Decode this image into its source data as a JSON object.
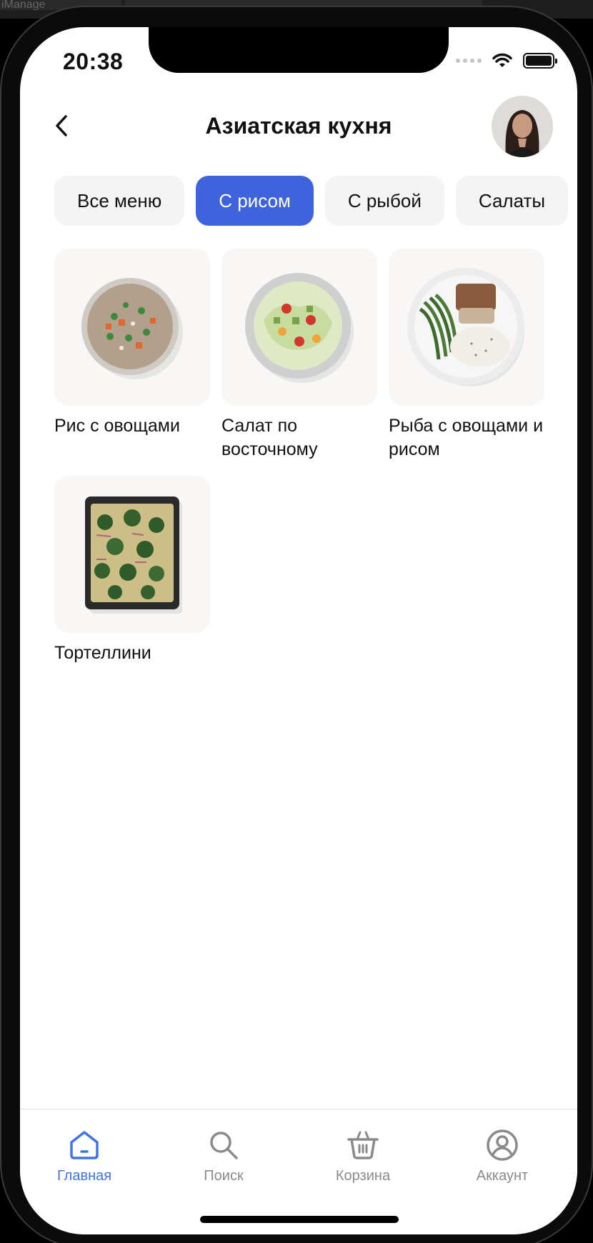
{
  "background_tab": {
    "label": "iManage"
  },
  "status_bar": {
    "time": "20:38"
  },
  "header": {
    "title": "Азиатская кухня"
  },
  "categories": [
    {
      "label": "Все меню",
      "active": false
    },
    {
      "label": "С рисом",
      "active": true
    },
    {
      "label": "С рыбой",
      "active": false
    },
    {
      "label": "Салаты",
      "active": false
    }
  ],
  "dishes": [
    {
      "name": "Рис с овощами",
      "image": "rice-with-vegetables-bowl"
    },
    {
      "name": "Салат по восточному",
      "image": "oriental-salad-bowl"
    },
    {
      "name": "Рыба с овощами и рисом",
      "image": "fish-vegetables-rice-plate"
    },
    {
      "name": "Тортеллини",
      "image": "tortellini-baking-tray"
    }
  ],
  "tabbar": {
    "items": [
      {
        "label": "Главная",
        "icon": "home-icon",
        "active": true
      },
      {
        "label": "Поиск",
        "icon": "search-icon",
        "active": false
      },
      {
        "label": "Корзина",
        "icon": "basket-icon",
        "active": false
      },
      {
        "label": "Аккаунт",
        "icon": "account-icon",
        "active": false
      }
    ]
  },
  "colors": {
    "accent": "#3E63DD",
    "tab_active": "#3F74E6",
    "tab_inactive": "#8A8A8A",
    "chip_bg": "#F4F4F4",
    "card_bg": "#F8F7F6"
  }
}
